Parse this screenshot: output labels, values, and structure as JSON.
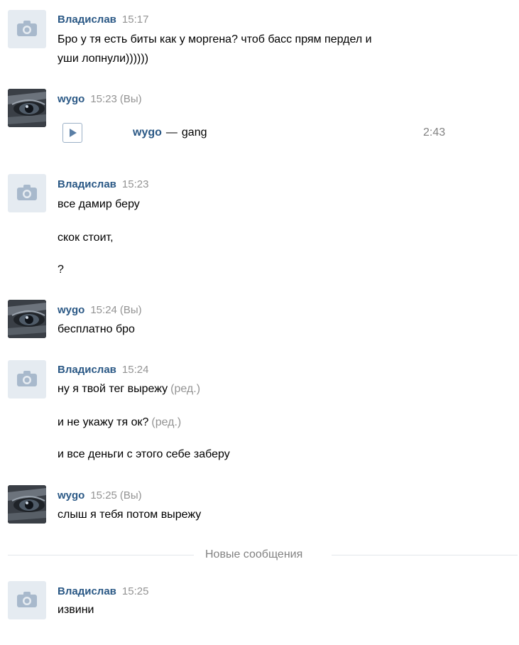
{
  "colors": {
    "name": "#2a5885",
    "meta": "#939393",
    "divider": "#e3e6ea",
    "avatar_bg": "#e5ebf1"
  },
  "messages": [
    {
      "author": "Владислав",
      "time": "15:17",
      "avatar": "camera-icon",
      "lines": [
        "Бро у тя есть биты как у моргена? чтоб басс прям пердел и",
        "уши лопнули))))))"
      ]
    },
    {
      "author": "wygo",
      "time": "15:23",
      "you": "(Вы)",
      "avatar": "user-avatar",
      "audio": {
        "artist": "wygo",
        "separator": "—",
        "title": "gang",
        "duration": "2:43"
      }
    },
    {
      "author": "Владислав",
      "time": "15:23",
      "avatar": "camera-icon",
      "lines": [
        "все дамир беру",
        "скок стоит,",
        "?"
      ]
    },
    {
      "author": "wygo",
      "time": "15:24",
      "you": "(Вы)",
      "avatar": "user-avatar",
      "lines": [
        "бесплатно бро"
      ]
    },
    {
      "author": "Владислав",
      "time": "15:24",
      "avatar": "camera-icon",
      "lines": [
        {
          "text": "ну я твой тег вырежу",
          "edited": "(ред.)"
        },
        {
          "text": "и не укажу тя ок?",
          "edited": "(ред.)"
        },
        {
          "text": "и все деньги с этого себе заберу"
        }
      ]
    },
    {
      "author": "wygo",
      "time": "15:25",
      "you": "(Вы)",
      "avatar": "user-avatar",
      "lines": [
        "слыш я тебя потом вырежу"
      ]
    },
    {
      "author": "Владислав",
      "time": "15:25",
      "avatar": "camera-icon",
      "lines": [
        "извини"
      ]
    }
  ],
  "new_messages_label": "Новые сообщения"
}
